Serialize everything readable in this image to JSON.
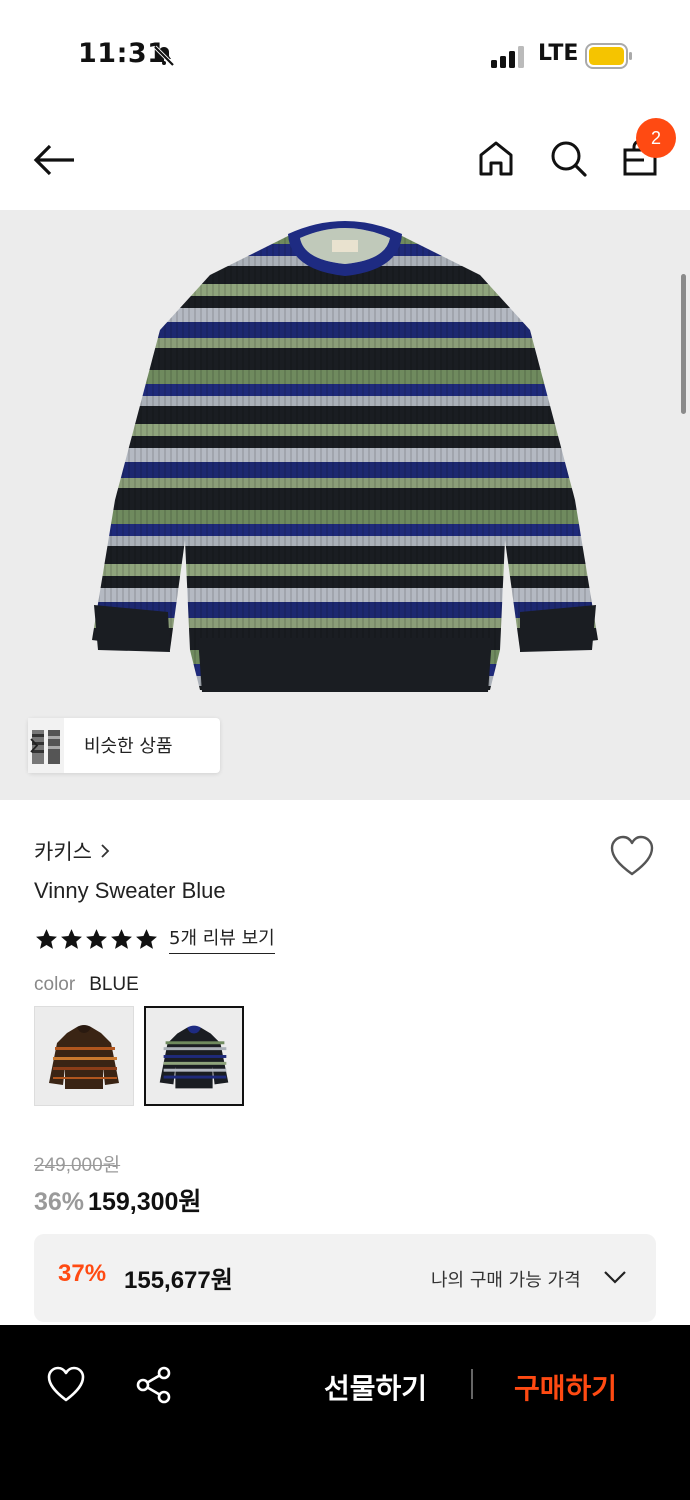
{
  "status_bar": {
    "time": "11:31",
    "network": "LTE",
    "battery_color": "#f5c400"
  },
  "nav": {
    "cart_count": "2"
  },
  "hero": {
    "similar_label": "비슷한 상품"
  },
  "product": {
    "brand": "카키스",
    "name": "Vinny Sweater Blue",
    "rating_stars": 5,
    "review_link": "5개 리뷰 보기",
    "color_label": "color",
    "color_value": "BLUE",
    "swatches": [
      "brown-stripe",
      "blue-stripe"
    ],
    "original_price": "249,000원",
    "discount": "36%",
    "sale_price": "159,300원"
  },
  "my_price": {
    "discount": "37%",
    "price": "155,677원",
    "label": "나의 구매 가능 가격"
  },
  "bottom_bar": {
    "gift_label": "선물하기",
    "buy_label": "구매하기"
  },
  "colors": {
    "accent": "#ff4a12",
    "muted": "#9a9a9a"
  }
}
